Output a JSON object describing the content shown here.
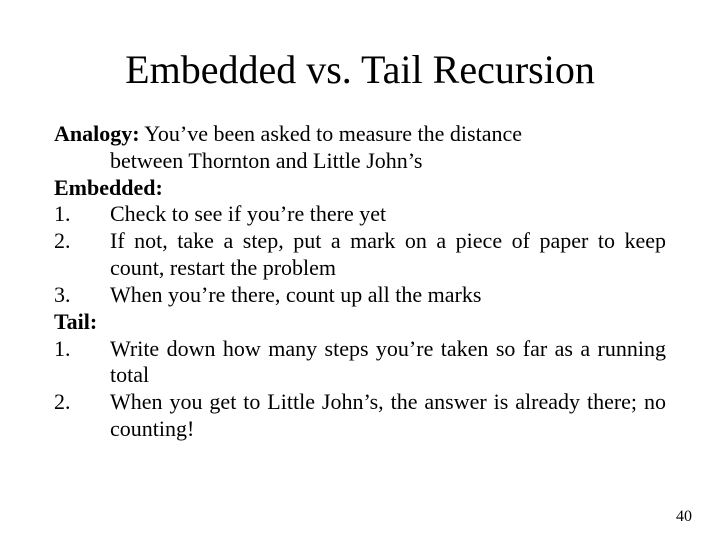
{
  "title": "Embedded vs. Tail Recursion",
  "analogy_label": "Analogy:",
  "analogy_text_first": "  You’ve  been  asked  to  measure  the  distance",
  "analogy_text_cont": "between Thornton and Little John’s",
  "embedded_label": "Embedded:",
  "emb1_num": "1.",
  "emb1_text": "Check to see if you’re there yet",
  "emb2_num": "2.",
  "emb2_text": "If not, take a step, put a mark on a piece of paper to keep count, restart the problem",
  "emb3_num": "3.",
  "emb3_text": "When you’re there, count up all the marks",
  "tail_label": "Tail:",
  "tail1_num": "1.",
  "tail1_text": "Write down how many steps you’re taken so far as a running total",
  "tail2_num": "2.",
  "tail2_text": "When you get to Little John’s, the answer is already there; no counting!",
  "page_number": "40"
}
